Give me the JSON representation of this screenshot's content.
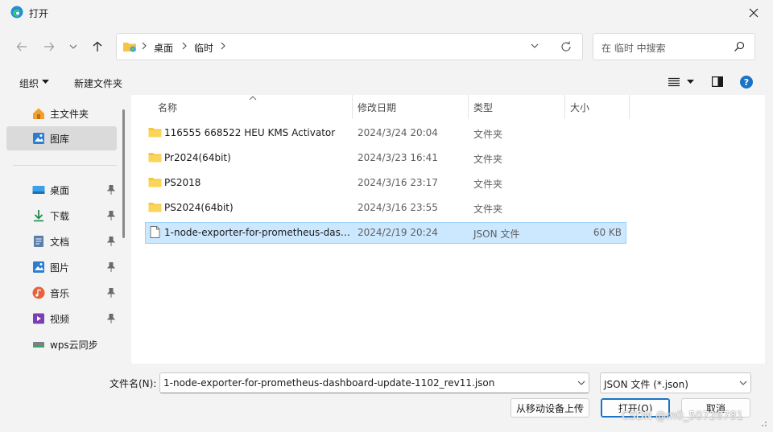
{
  "window": {
    "title": "打开"
  },
  "address": {
    "crumbs": [
      "桌面",
      "临时"
    ]
  },
  "search": {
    "placeholder": "在 临时 中搜索"
  },
  "toolbar": {
    "organize": "组织",
    "new_folder": "新建文件夹"
  },
  "sidebar": {
    "top_items": [
      {
        "label": "主文件夹"
      },
      {
        "label": "图库"
      }
    ],
    "items": [
      {
        "label": "桌面"
      },
      {
        "label": "下载"
      },
      {
        "label": "文档"
      },
      {
        "label": "图片"
      },
      {
        "label": "音乐"
      },
      {
        "label": "视频"
      },
      {
        "label": "wps云同步"
      }
    ]
  },
  "columns": {
    "name": "名称",
    "date": "修改日期",
    "type": "类型",
    "size": "大小"
  },
  "files": [
    {
      "name": "116555 668522 HEU KMS Activator",
      "date": "2024/3/24 20:04",
      "type": "文件夹",
      "size": ""
    },
    {
      "name": "Pr2024(64bit)",
      "date": "2024/3/23 16:41",
      "type": "文件夹",
      "size": ""
    },
    {
      "name": "PS2018",
      "date": "2024/3/16 23:17",
      "type": "文件夹",
      "size": ""
    },
    {
      "name": "PS2024(64bit)",
      "date": "2024/3/16 23:55",
      "type": "文件夹",
      "size": ""
    },
    {
      "name": "1-node-exporter-for-prometheus-dashboard-update-1102_rev11.json",
      "date": "2024/2/19 20:24",
      "type": "JSON 文件",
      "size": "60 KB"
    }
  ],
  "bottom": {
    "filename_label": "文件名(N):",
    "filename_value": "1-node-exporter-for-prometheus-dashboard-update-1102_rev11.json",
    "filter_value": "JSON 文件 (*.json)",
    "upload_label": "从移动设备上传",
    "open_label": "打开(O)",
    "cancel_label": "取消"
  },
  "watermark": "CSDN @m0_50726781",
  "colors": {
    "accent": "#0067c0",
    "folder": "#f5c542",
    "selection": "#cce8ff"
  }
}
